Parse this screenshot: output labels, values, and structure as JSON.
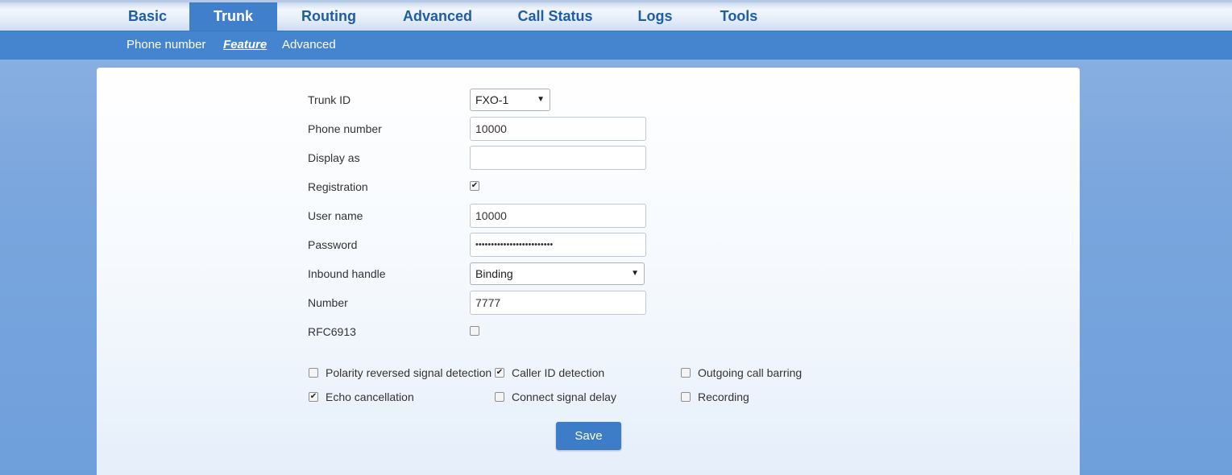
{
  "top_nav": {
    "tabs": [
      {
        "label": "Basic"
      },
      {
        "label": "Trunk"
      },
      {
        "label": "Routing"
      },
      {
        "label": "Advanced"
      },
      {
        "label": "Call Status"
      },
      {
        "label": "Logs"
      },
      {
        "label": "Tools"
      }
    ],
    "active": "Trunk"
  },
  "sub_nav": {
    "items": [
      {
        "label": "Phone number"
      },
      {
        "label": "Feature"
      },
      {
        "label": "Advanced"
      }
    ],
    "active": "Feature"
  },
  "form": {
    "trunk_id": {
      "label": "Trunk ID",
      "value": "FXO-1"
    },
    "phone_number": {
      "label": "Phone number",
      "value": "10000"
    },
    "display_as": {
      "label": "Display as",
      "value": ""
    },
    "registration": {
      "label": "Registration",
      "checked": true
    },
    "user_name": {
      "label": "User name",
      "value": "10000"
    },
    "password": {
      "label": "Password",
      "value": "•••••••••••••••••••••••••"
    },
    "inbound_handle": {
      "label": "Inbound handle",
      "value": "Binding"
    },
    "number": {
      "label": "Number",
      "value": "7777"
    },
    "rfc6913": {
      "label": "RFC6913",
      "checked": false
    }
  },
  "options": [
    {
      "label": "Polarity reversed signal detection",
      "checked": false
    },
    {
      "label": "Caller ID detection",
      "checked": true
    },
    {
      "label": "Outgoing call barring",
      "checked": false
    },
    {
      "label": "Echo cancellation",
      "checked": true
    },
    {
      "label": "Connect signal delay",
      "checked": false
    },
    {
      "label": "Recording",
      "checked": false
    }
  ],
  "save_label": "Save",
  "check_glyph": "✔",
  "arrow_glyph": "▼",
  "colors": {
    "accent": "#3f7fcb",
    "sub_nav_bg": "#4585d0",
    "nav_text": "#1f5da4",
    "button": "#3d7cc6"
  }
}
